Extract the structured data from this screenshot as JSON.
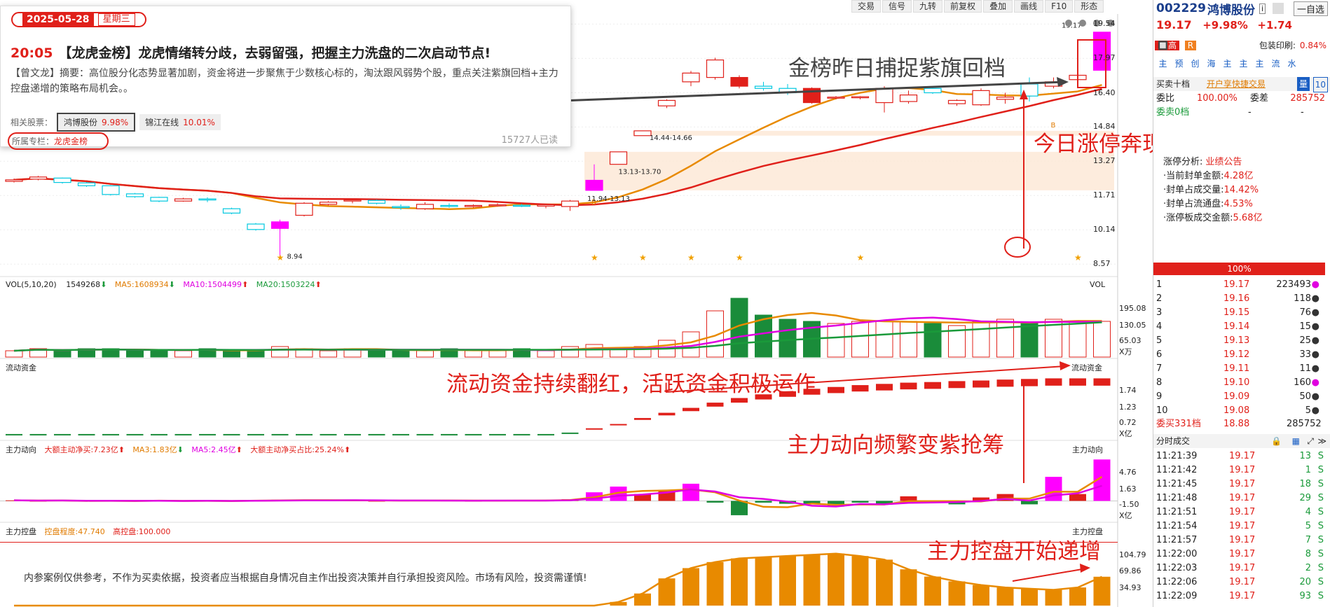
{
  "toolbar": {
    "items": [
      "交易",
      "信号",
      "九转",
      "前复权",
      "叠加",
      "画线",
      "F10",
      "形态"
    ]
  },
  "news": {
    "date": "2025-05-28",
    "weekday": "星期三",
    "time": "20:05",
    "title": "【龙虎金榜】龙虎情绪转分歧，去弱留强，把握主力洗盘的二次启动节点!",
    "summary": "【曾文龙】摘要：高位股分化态势显著加剧，资金将进一步聚焦于少数核心标的，淘汰跟风弱势个股，重点关注紫旗回档+主力控盘递增的策略布局机会。。",
    "related_label": "相关股票：",
    "related": [
      {
        "name": "鸿博股份",
        "pct": "9.98%"
      },
      {
        "name": "锦江在线",
        "pct": "10.01%"
      }
    ],
    "column_label": "所属专栏：",
    "column_value": "龙虎金榜",
    "reads": "15727人已读"
  },
  "price_axis": [
    "19.54",
    "17.97",
    "16.40",
    "14.84",
    "13.27",
    "11.71",
    "10.14",
    "8.57"
  ],
  "price_marks": {
    "low": "8.94",
    "zone1": "11.94-13.13",
    "zone2": "13.13-13.70",
    "zone3": "14.44-14.66",
    "high": "19.17"
  },
  "vol_header": {
    "name": "VOL(5,10,20)",
    "value": "1549268",
    "ma5": "MA5:1608934",
    "ma10": "MA10:1504499",
    "ma20": "MA20:1503224",
    "label": "VOL"
  },
  "vol_axis": [
    "195.08",
    "130.05",
    "65.03",
    "X万"
  ],
  "flow_header": {
    "name": "流动资金",
    "label": "流动资金"
  },
  "flow_axis": [
    "1.74",
    "1.23",
    "0.72",
    "X亿"
  ],
  "main_header": {
    "name": "主力动向",
    "net": "大额主动净买:7.23亿",
    "ma3": "MA3:1.83亿",
    "ma5": "MA5:2.45亿",
    "ratio": "大额主动净买占比:25.24%",
    "label": "主力动向"
  },
  "main_axis": [
    "4.76",
    "1.63",
    "-1.50",
    "X亿"
  ],
  "ctrl_header": {
    "name": "主力控盘",
    "degree": "控盘程度:47.740",
    "high": "高控盘:100.000",
    "label": "主力控盘"
  },
  "ctrl_axis": [
    "104.79",
    "69.86",
    "34.93"
  ],
  "disclaimer": "内参案例仅供参考，不作为买卖依据，投资者应当根据自身情况自主作出投资决策并自行承担投资风险。市场有风险，投资需谨慎!",
  "annotations": {
    "a1": "金榜昨日捕捉紫旗回档",
    "a2": "今日涨停奔现!",
    "a3": "流动资金持续翻红，活跃资金积极运作",
    "a4": "主力动向频繁变紫抢筹",
    "a5": "主力控盘开始递增"
  },
  "colors": {
    "up": "#e0201a",
    "down": "#1a8c3a",
    "cyan": "#00c8e0",
    "purple": "#ff00ff",
    "ma_orange": "#e88a00"
  },
  "candles": [
    [
      12.35,
      12.48,
      12.3,
      12.42
    ],
    [
      12.45,
      12.6,
      12.4,
      12.55
    ],
    [
      12.5,
      12.52,
      12.25,
      12.3
    ],
    [
      12.28,
      12.32,
      12.1,
      12.15
    ],
    [
      12.15,
      12.18,
      11.7,
      11.75
    ],
    [
      11.78,
      11.82,
      11.6,
      11.65
    ],
    [
      11.62,
      11.65,
      11.4,
      11.45
    ],
    [
      11.45,
      11.6,
      11.42,
      11.55
    ],
    [
      11.55,
      11.62,
      11.4,
      11.5
    ],
    [
      11.1,
      11.15,
      10.85,
      10.9
    ],
    [
      10.4,
      10.45,
      10.1,
      10.15
    ],
    [
      10.2,
      10.6,
      8.94,
      10.5
    ],
    [
      10.8,
      11.4,
      10.75,
      11.35
    ],
    [
      11.3,
      11.45,
      11.25,
      11.4
    ],
    [
      11.45,
      11.55,
      11.35,
      11.5
    ],
    [
      11.48,
      11.52,
      11.3,
      11.35
    ],
    [
      11.2,
      11.3,
      11.05,
      11.15
    ],
    [
      11.1,
      11.4,
      11.05,
      11.3
    ],
    [
      11.25,
      11.35,
      11.15,
      11.22
    ],
    [
      11.2,
      11.3,
      11.15,
      11.25
    ],
    [
      11.25,
      11.35,
      11.2,
      11.28
    ],
    [
      11.26,
      11.32,
      11.18,
      11.24
    ],
    [
      11.22,
      11.3,
      11.12,
      11.28
    ],
    [
      11.2,
      11.5,
      11.0,
      11.45
    ],
    [
      11.94,
      13.13,
      11.94,
      12.4
    ],
    [
      13.13,
      13.7,
      13.13,
      13.7
    ],
    [
      14.44,
      14.66,
      14.44,
      14.66
    ],
    [
      15.8,
      16.1,
      15.7,
      16.05
    ],
    [
      16.9,
      17.4,
      16.7,
      17.3
    ],
    [
      17.1,
      18.0,
      17.0,
      17.9
    ],
    [
      17.1,
      17.2,
      16.6,
      16.7
    ],
    [
      16.7,
      16.9,
      16.5,
      16.6
    ],
    [
      16.6,
      16.8,
      16.3,
      16.4
    ],
    [
      16.6,
      16.65,
      15.9,
      15.95
    ],
    [
      16.2,
      16.25,
      16.1,
      16.2
    ],
    [
      16.2,
      16.25,
      16.1,
      16.22
    ],
    [
      15.95,
      16.7,
      15.5,
      16.6
    ],
    [
      16.0,
      16.5,
      15.9,
      16.3
    ],
    [
      16.6,
      16.7,
      16.35,
      16.4
    ],
    [
      15.9,
      16.1,
      15.8,
      16.05
    ],
    [
      15.85,
      16.6,
      15.8,
      16.5
    ],
    [
      16.1,
      16.4,
      15.9,
      16.2
    ],
    [
      16.8,
      17.1,
      16.0,
      16.25
    ],
    [
      16.7,
      17.1,
      16.6,
      16.9
    ],
    [
      17.0,
      17.3,
      16.9,
      17.2
    ],
    [
      17.43,
      19.17,
      17.43,
      19.17
    ]
  ],
  "vol": [
    3,
    4,
    3,
    4,
    4,
    3,
    3,
    3,
    4,
    3,
    3,
    5,
    4,
    3,
    4,
    3,
    3,
    3,
    4,
    3,
    3,
    4,
    3,
    5,
    6,
    4,
    5,
    8,
    12,
    22,
    28,
    20,
    18,
    17,
    16,
    17,
    17,
    17,
    16,
    15,
    17,
    18,
    16,
    18,
    17,
    17
  ],
  "flow": [
    -0.1,
    -0.1,
    -0.1,
    -0.1,
    -0.1,
    -0.1,
    -0.1,
    -0.1,
    -0.1,
    -0.1,
    -0.1,
    -0.1,
    -0.1,
    -0.1,
    -0.1,
    -0.1,
    -0.1,
    -0.1,
    -0.1,
    -0.1,
    -0.1,
    -0.1,
    -0.1,
    -0.05,
    0.1,
    0.25,
    0.45,
    0.62,
    0.78,
    0.95,
    1.1,
    1.22,
    1.32,
    1.4,
    1.46,
    1.52,
    1.56,
    1.6,
    1.62,
    1.65,
    1.67,
    1.7,
    1.72,
    1.74,
    1.74,
    1.74
  ],
  "main": [
    0.1,
    0.0,
    0.1,
    -0.1,
    0.05,
    0.0,
    0.05,
    -0.05,
    0.05,
    -0.05,
    0.1,
    0.2,
    0.1,
    0.1,
    0.1,
    0.0,
    0.05,
    0.1,
    0.05,
    0.0,
    0.05,
    0.1,
    0.05,
    0.3,
    1.5,
    2.5,
    1.2,
    1.8,
    3.0,
    -0.3,
    -2.5,
    -0.3,
    -0.5,
    -0.6,
    -1.0,
    -0.3,
    -0.6,
    0.8,
    -0.3,
    -0.6,
    0.6,
    1.2,
    -0.6,
    4.2,
    1.2,
    7.23
  ],
  "ctrl": [
    0,
    0,
    0,
    0,
    0,
    0,
    0,
    0,
    0,
    0,
    0,
    0,
    0,
    0,
    0,
    0,
    0,
    0,
    0,
    0,
    0,
    0,
    0,
    0,
    0,
    6,
    20,
    45,
    62,
    72,
    78,
    80,
    82,
    84,
    86,
    82,
    76,
    60,
    48,
    40,
    34,
    30,
    28,
    26,
    30,
    47.74
  ],
  "right_panel": {
    "code": "002229",
    "name": "鸿博股份",
    "add": "一自选",
    "price": "19.17",
    "change_pct": "+9.98%",
    "change": "+1.74",
    "tag_high": "高",
    "tag_r": "R",
    "pledge_label": "包装印刷:",
    "pledge_value": "0.84%",
    "icons": [
      "主",
      "预",
      "创",
      "海",
      "主",
      "主",
      "主",
      "流",
      "水"
    ],
    "ob_title": "买卖十档",
    "ob_link": "开户享快捷交易",
    "ob_btn": "量",
    "ob_num": "10",
    "webi_label": "委比",
    "webi_value": "100.00%",
    "weicha_label": "委差",
    "weicha_value": "285752",
    "sell_label": "委卖0档",
    "sell_a": "-",
    "sell_b": "-",
    "limit_label": "涨停分析:",
    "limit_reason": "业绩公告",
    "limit_items": [
      {
        "k": "·当前封单金额:",
        "v": "4.28亿"
      },
      {
        "k": "·封单占成交量:",
        "v": "14.42%"
      },
      {
        "k": "·封单占流通盘:",
        "v": "4.53%"
      },
      {
        "k": "·涨停板成交金额:",
        "v": "5.68亿"
      }
    ],
    "pct_bar": "100%",
    "bids": [
      {
        "n": "1",
        "p": "19.17",
        "v": "223493",
        "dot": "purple"
      },
      {
        "n": "2",
        "p": "19.16",
        "v": "118",
        "dot": "black"
      },
      {
        "n": "3",
        "p": "19.15",
        "v": "76",
        "dot": "black"
      },
      {
        "n": "4",
        "p": "19.14",
        "v": "15",
        "dot": "black"
      },
      {
        "n": "5",
        "p": "19.13",
        "v": "25",
        "dot": "black"
      },
      {
        "n": "6",
        "p": "19.12",
        "v": "33",
        "dot": "black"
      },
      {
        "n": "7",
        "p": "19.11",
        "v": "11",
        "dot": "black"
      },
      {
        "n": "8",
        "p": "19.10",
        "v": "160",
        "dot": "purple"
      },
      {
        "n": "9",
        "p": "19.09",
        "v": "50",
        "dot": "black"
      },
      {
        "n": "10",
        "p": "19.08",
        "v": "5",
        "dot": "black"
      }
    ],
    "buy_label": "委买331档",
    "buy_price": "18.88",
    "buy_total": "285752",
    "trades_title": "分时成交",
    "trades": [
      {
        "t": "11:21:39",
        "p": "19.17",
        "v": "13",
        "s": "S"
      },
      {
        "t": "11:21:42",
        "p": "19.17",
        "v": "1",
        "s": "S"
      },
      {
        "t": "11:21:45",
        "p": "19.17",
        "v": "18",
        "s": "S"
      },
      {
        "t": "11:21:48",
        "p": "19.17",
        "v": "29",
        "s": "S"
      },
      {
        "t": "11:21:51",
        "p": "19.17",
        "v": "4",
        "s": "S"
      },
      {
        "t": "11:21:54",
        "p": "19.17",
        "v": "5",
        "s": "S"
      },
      {
        "t": "11:21:57",
        "p": "19.17",
        "v": "7",
        "s": "S"
      },
      {
        "t": "11:22:00",
        "p": "19.17",
        "v": "8",
        "s": "S"
      },
      {
        "t": "11:22:03",
        "p": "19.17",
        "v": "2",
        "s": "S"
      },
      {
        "t": "11:22:06",
        "p": "19.17",
        "v": "20",
        "s": "S"
      },
      {
        "t": "11:22:09",
        "p": "19.17",
        "v": "93",
        "s": "S"
      }
    ]
  }
}
